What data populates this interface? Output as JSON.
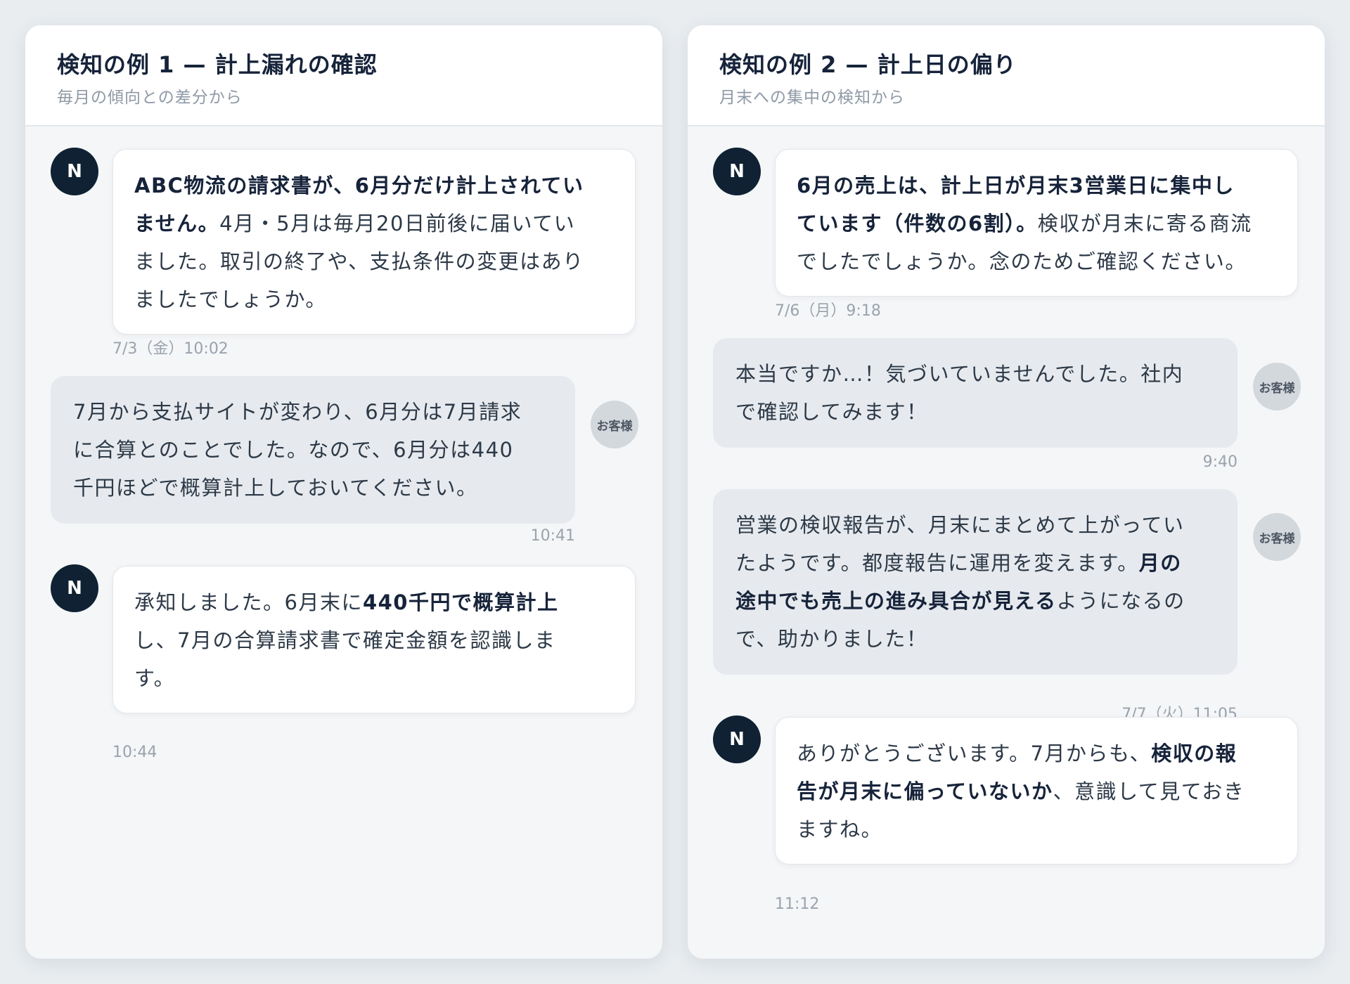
{
  "panels": [
    {
      "title": "検知の例 1 — 計上漏れの確認",
      "subtitle": "毎月の傾向との差分から",
      "messages": [
        {
          "sender": "N",
          "lines": [
            [
              {
                "t": "ABC物流の請求書が、6月分だけ計上されてい",
                "b": true
              }
            ],
            [
              {
                "t": "ません。",
                "b": true
              },
              {
                "t": "4月・5月は毎月20日前後に届いてい",
                "b": false
              }
            ],
            [
              {
                "t": "ました。取引の終了や、支払条件の変更はあり",
                "b": false
              }
            ],
            [
              {
                "t": "ましたでしょうか。",
                "b": false
              }
            ]
          ],
          "timestamp": "7/3（金）10:02"
        },
        {
          "sender": "お客様",
          "lines": [
            [
              {
                "t": "7月から支払サイトが変わり、6月分は7月請求",
                "b": false
              }
            ],
            [
              {
                "t": "に合算とのことでした。なので、6月分は440",
                "b": false
              }
            ],
            [
              {
                "t": "千円ほどで概算計上しておいてください。",
                "b": false
              }
            ]
          ],
          "timestamp": "10:41"
        },
        {
          "sender": "N",
          "lines": [
            [
              {
                "t": "承知しました。6月末に",
                "b": false
              },
              {
                "t": "440千円で概算計上",
                "b": true
              }
            ],
            [
              {
                "t": "し、7月の合算請求書で確定金額を認識しま",
                "b": false
              }
            ],
            [
              {
                "t": "す。",
                "b": false
              }
            ]
          ],
          "timestamp": "10:44"
        }
      ]
    },
    {
      "title": "検知の例 2 — 計上日の偏り",
      "subtitle": "月末への集中の検知から",
      "messages": [
        {
          "sender": "N",
          "lines": [
            [
              {
                "t": "6月の売上は、計上日が月末3営業日に集中し",
                "b": true
              }
            ],
            [
              {
                "t": "ています（件数の6割）。",
                "b": true
              },
              {
                "t": "検収が月末に寄る商流",
                "b": false
              }
            ],
            [
              {
                "t": "でしたでしょうか。念のためご確認ください。",
                "b": false
              }
            ]
          ],
          "timestamp": "7/6（月）9:18"
        },
        {
          "sender": "お客様",
          "lines": [
            [
              {
                "t": "本当ですか…！気づいていませんでした。社内",
                "b": false
              }
            ],
            [
              {
                "t": "で確認してみます！",
                "b": false
              }
            ]
          ],
          "timestamp": "9:40"
        },
        {
          "sender": "お客様",
          "lines": [
            [
              {
                "t": "営業の検収報告が、月末にまとめて上がってい",
                "b": false
              }
            ],
            [
              {
                "t": "たようです。都度報告に運用を変えます。",
                "b": false
              },
              {
                "t": "月の",
                "b": true
              }
            ],
            [
              {
                "t": "途中でも売上の進み具合が見える",
                "b": true
              },
              {
                "t": "ようになるの",
                "b": false
              }
            ],
            [
              {
                "t": "で、助かりました！",
                "b": false
              }
            ]
          ],
          "timestamp": "7/7（火）11:05"
        },
        {
          "sender": "N",
          "lines": [
            [
              {
                "t": "ありがとうございます。7月からも、",
                "b": false
              },
              {
                "t": "検収の報",
                "b": true
              }
            ],
            [
              {
                "t": "告が月末に偏っていないか",
                "b": true
              },
              {
                "t": "、意識して見ておき",
                "b": false
              }
            ],
            [
              {
                "t": "ますね。",
                "b": false
              }
            ]
          ],
          "timestamp": "11:12"
        }
      ]
    }
  ]
}
